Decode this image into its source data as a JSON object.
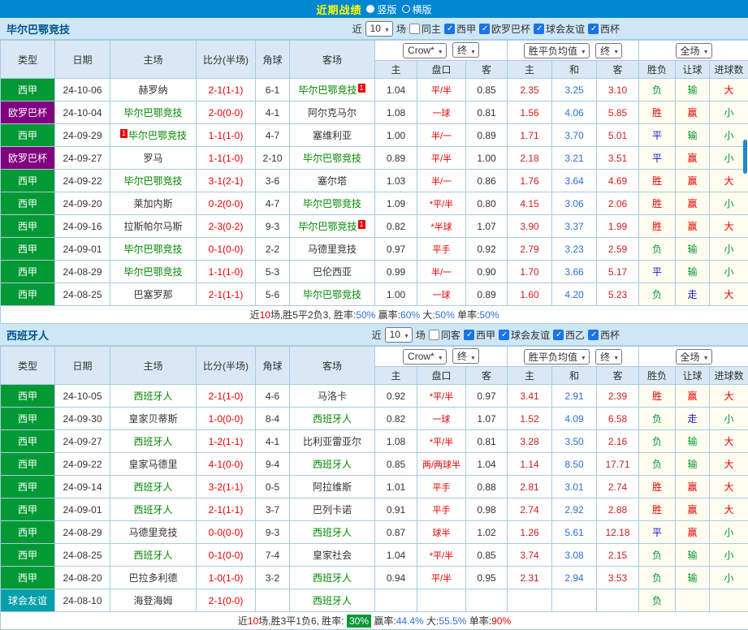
{
  "topbar": {
    "title": "近期战绩",
    "vertical": "竖版",
    "vertical_checked": true,
    "horizontal": "横版",
    "horizontal_checked": false
  },
  "colors": {
    "topbar_bg": "#0086d1",
    "title": "#ffff00",
    "section_bg": "#cde7f6",
    "league_green": "#009933",
    "league_purple": "#800080",
    "league_teal": "#00a0aa",
    "win_red": "#e60000",
    "lose_green": "#009933",
    "draw_blue": "#1414cc",
    "draw_odds_blue": "#2e6fd9",
    "badge_green": "#009933"
  },
  "sections": [
    {
      "team": "毕尔巴鄂竞技",
      "filter": {
        "near": "近",
        "count": "10",
        "games": "场",
        "same": {
          "label": "同主",
          "checked": false
        },
        "leagues": [
          {
            "label": "西甲",
            "checked": true
          },
          {
            "label": "欧罗巴杯",
            "checked": true
          },
          {
            "label": "球会友谊",
            "checked": true
          },
          {
            "label": "西杯",
            "checked": true
          }
        ]
      },
      "header": {
        "type": "类型",
        "date": "日期",
        "home": "主场",
        "score": "比分(半场)",
        "corner": "角球",
        "away": "客场",
        "odds_source": "Crow*",
        "odds_stage": "终",
        "europe_source": "胜平负均值",
        "europe_stage": "终",
        "scope": "全场",
        "sub": [
          "主",
          "盘口",
          "客",
          "主",
          "和",
          "客",
          "胜负",
          "让球",
          "进球数"
        ]
      },
      "rows": [
        {
          "league": "西甲",
          "lc": "green",
          "date": "24-10-06",
          "hpre": "",
          "home": "赫罗纳",
          "hpost": "",
          "hhl": false,
          "score": "2-1(1-1)",
          "corner": "6-1",
          "apre": "",
          "away": "毕尔巴鄂竞技",
          "apost": "1",
          "ahl": true,
          "oh": "1.04",
          "hcap": "平/半",
          "oa": "0.85",
          "eh": "2.35",
          "ed": "3.25",
          "ea": "3.10",
          "res": "负",
          "resc": "g",
          "hres": "输",
          "hresc": "g",
          "gres": "大",
          "gresc": "r"
        },
        {
          "league": "欧罗巴杯",
          "lc": "purple",
          "date": "24-10-04",
          "hpre": "",
          "home": "毕尔巴鄂竞技",
          "hpost": "",
          "hhl": true,
          "score": "2-0(0-0)",
          "corner": "4-1",
          "apre": "",
          "away": "阿尔克马尔",
          "apost": "",
          "ahl": false,
          "oh": "1.08",
          "hcap": "一球",
          "oa": "0.81",
          "eh": "1.56",
          "ed": "4.06",
          "ea": "5.85",
          "res": "胜",
          "resc": "r",
          "hres": "赢",
          "hresc": "r",
          "gres": "小",
          "gresc": "g"
        },
        {
          "league": "西甲",
          "lc": "green",
          "date": "24-09-29",
          "hpre": "1",
          "home": "毕尔巴鄂竞技",
          "hpost": "",
          "hhl": true,
          "score": "1-1(1-0)",
          "corner": "4-7",
          "apre": "",
          "away": "塞维利亚",
          "apost": "",
          "ahl": false,
          "oh": "1.00",
          "hcap": "半/一",
          "oa": "0.89",
          "eh": "1.71",
          "ed": "3.70",
          "ea": "5.01",
          "res": "平",
          "resc": "b",
          "hres": "输",
          "hresc": "g",
          "gres": "小",
          "gresc": "g"
        },
        {
          "league": "欧罗巴杯",
          "lc": "purple",
          "date": "24-09-27",
          "hpre": "",
          "home": "罗马",
          "hpost": "",
          "hhl": false,
          "score": "1-1(1-0)",
          "corner": "2-10",
          "apre": "",
          "away": "毕尔巴鄂竞技",
          "apost": "",
          "ahl": true,
          "oh": "0.89",
          "hcap": "平/半",
          "oa": "1.00",
          "eh": "2.18",
          "ed": "3.21",
          "ea": "3.51",
          "res": "平",
          "resc": "b",
          "hres": "赢",
          "hresc": "r",
          "gres": "小",
          "gresc": "g"
        },
        {
          "league": "西甲",
          "lc": "green",
          "date": "24-09-22",
          "hpre": "",
          "home": "毕尔巴鄂竞技",
          "hpost": "",
          "hhl": true,
          "score": "3-1(2-1)",
          "corner": "3-6",
          "apre": "",
          "away": "塞尔塔",
          "apost": "",
          "ahl": false,
          "oh": "1.03",
          "hcap": "半/一",
          "oa": "0.86",
          "eh": "1.76",
          "ed": "3.64",
          "ea": "4.69",
          "res": "胜",
          "resc": "r",
          "hres": "赢",
          "hresc": "r",
          "gres": "大",
          "gresc": "r"
        },
        {
          "league": "西甲",
          "lc": "green",
          "date": "24-09-20",
          "hpre": "",
          "home": "莱加内斯",
          "hpost": "",
          "hhl": false,
          "score": "0-2(0-0)",
          "corner": "4-7",
          "apre": "",
          "away": "毕尔巴鄂竞技",
          "apost": "",
          "ahl": true,
          "oh": "1.09",
          "hcap": "*平/半",
          "oa": "0.80",
          "eh": "4.15",
          "ed": "3.06",
          "ea": "2.06",
          "res": "胜",
          "resc": "r",
          "hres": "赢",
          "hresc": "r",
          "gres": "小",
          "gresc": "g"
        },
        {
          "league": "西甲",
          "lc": "green",
          "date": "24-09-16",
          "hpre": "",
          "home": "拉斯帕尔马斯",
          "hpost": "",
          "hhl": false,
          "score": "2-3(0-2)",
          "corner": "9-3",
          "apre": "",
          "away": "毕尔巴鄂竞技",
          "apost": "1",
          "ahl": true,
          "oh": "0.82",
          "hcap": "*半球",
          "oa": "1.07",
          "eh": "3.90",
          "ed": "3.37",
          "ea": "1.99",
          "res": "胜",
          "resc": "r",
          "hres": "赢",
          "hresc": "r",
          "gres": "大",
          "gresc": "r"
        },
        {
          "league": "西甲",
          "lc": "green",
          "date": "24-09-01",
          "hpre": "",
          "home": "毕尔巴鄂竞技",
          "hpost": "",
          "hhl": true,
          "score": "0-1(0-0)",
          "corner": "2-2",
          "apre": "",
          "away": "马德里竞技",
          "apost": "",
          "ahl": false,
          "oh": "0.97",
          "hcap": "平手",
          "oa": "0.92",
          "eh": "2.79",
          "ed": "3.23",
          "ea": "2.59",
          "res": "负",
          "resc": "g",
          "hres": "输",
          "hresc": "g",
          "gres": "小",
          "gresc": "g"
        },
        {
          "league": "西甲",
          "lc": "green",
          "date": "24-08-29",
          "hpre": "",
          "home": "毕尔巴鄂竞技",
          "hpost": "",
          "hhl": true,
          "score": "1-1(1-0)",
          "corner": "5-3",
          "apre": "",
          "away": "巴伦西亚",
          "apost": "",
          "ahl": false,
          "oh": "0.99",
          "hcap": "半/一",
          "oa": "0.90",
          "eh": "1.70",
          "ed": "3.66",
          "ea": "5.17",
          "res": "平",
          "resc": "b",
          "hres": "输",
          "hresc": "g",
          "gres": "小",
          "gresc": "g"
        },
        {
          "league": "西甲",
          "lc": "green",
          "date": "24-08-25",
          "hpre": "",
          "home": "巴塞罗那",
          "hpost": "",
          "hhl": false,
          "score": "2-1(1-1)",
          "corner": "5-6",
          "apre": "",
          "away": "毕尔巴鄂竞技",
          "apost": "",
          "ahl": true,
          "oh": "1.00",
          "hcap": "一球",
          "oa": "0.89",
          "eh": "1.60",
          "ed": "4.20",
          "ea": "5.23",
          "res": "负",
          "resc": "g",
          "hres": "走",
          "hresc": "b",
          "gres": "大",
          "gresc": "r"
        }
      ],
      "summary": [
        {
          "t": "近"
        },
        {
          "t": "10",
          "c": "#e60000"
        },
        {
          "t": "场,胜5平2负3, 胜率:"
        },
        {
          "t": "50%",
          "c": "#2e6fd9"
        },
        {
          "t": " 赢率:"
        },
        {
          "t": "60%",
          "c": "#2e6fd9"
        },
        {
          "t": " 大:"
        },
        {
          "t": "50%",
          "c": "#2e6fd9"
        },
        {
          "t": " 单率:"
        },
        {
          "t": "50%",
          "c": "#2e6fd9"
        }
      ]
    },
    {
      "team": "西班牙人",
      "filter": {
        "near": "近",
        "count": "10",
        "games": "场",
        "same": {
          "label": "同客",
          "checked": false
        },
        "leagues": [
          {
            "label": "西甲",
            "checked": true
          },
          {
            "label": "球会友谊",
            "checked": true
          },
          {
            "label": "西乙",
            "checked": true
          },
          {
            "label": "西杯",
            "checked": true
          }
        ]
      },
      "header": {
        "type": "类型",
        "date": "日期",
        "home": "主场",
        "score": "比分(半场)",
        "corner": "角球",
        "away": "客场",
        "odds_source": "Crow*",
        "odds_stage": "终",
        "europe_source": "胜平负均值",
        "europe_stage": "终",
        "scope": "全场",
        "sub": [
          "主",
          "盘口",
          "客",
          "主",
          "和",
          "客",
          "胜负",
          "让球",
          "进球数"
        ]
      },
      "rows": [
        {
          "league": "西甲",
          "lc": "green",
          "date": "24-10-05",
          "hpre": "",
          "home": "西班牙人",
          "hpost": "",
          "hhl": true,
          "score": "2-1(1-0)",
          "corner": "4-6",
          "apre": "",
          "away": "马洛卡",
          "apost": "",
          "ahl": false,
          "oh": "0.92",
          "hcap": "*平/半",
          "oa": "0.97",
          "eh": "3.41",
          "ed": "2.91",
          "ea": "2.39",
          "res": "胜",
          "resc": "r",
          "hres": "赢",
          "hresc": "r",
          "gres": "大",
          "gresc": "r"
        },
        {
          "league": "西甲",
          "lc": "green",
          "date": "24-09-30",
          "hpre": "",
          "home": "皇家贝蒂斯",
          "hpost": "",
          "hhl": false,
          "score": "1-0(0-0)",
          "corner": "8-4",
          "apre": "",
          "away": "西班牙人",
          "apost": "",
          "ahl": true,
          "oh": "0.82",
          "hcap": "一球",
          "oa": "1.07",
          "eh": "1.52",
          "ed": "4.09",
          "ea": "6.58",
          "res": "负",
          "resc": "g",
          "hres": "走",
          "hresc": "b",
          "gres": "小",
          "gresc": "g"
        },
        {
          "league": "西甲",
          "lc": "green",
          "date": "24-09-27",
          "hpre": "",
          "home": "西班牙人",
          "hpost": "",
          "hhl": true,
          "score": "1-2(1-1)",
          "corner": "4-1",
          "apre": "",
          "away": "比利亚雷亚尔",
          "apost": "",
          "ahl": false,
          "oh": "1.08",
          "hcap": "*平/半",
          "oa": "0.81",
          "eh": "3.28",
          "ed": "3.50",
          "ea": "2.16",
          "res": "负",
          "resc": "g",
          "hres": "输",
          "hresc": "g",
          "gres": "大",
          "gresc": "r"
        },
        {
          "league": "西甲",
          "lc": "green",
          "date": "24-09-22",
          "hpre": "",
          "home": "皇家马德里",
          "hpost": "",
          "hhl": false,
          "score": "4-1(0-0)",
          "corner": "9-4",
          "apre": "",
          "away": "西班牙人",
          "apost": "",
          "ahl": true,
          "oh": "0.85",
          "hcap": "两/两球半",
          "oa": "1.04",
          "eh": "1.14",
          "ed": "8.50",
          "ea": "17.71",
          "res": "负",
          "resc": "g",
          "hres": "输",
          "hresc": "g",
          "gres": "大",
          "gresc": "r"
        },
        {
          "league": "西甲",
          "lc": "green",
          "date": "24-09-14",
          "hpre": "",
          "home": "西班牙人",
          "hpost": "",
          "hhl": true,
          "score": "3-2(1-1)",
          "corner": "0-5",
          "apre": "",
          "away": "阿拉维斯",
          "apost": "",
          "ahl": false,
          "oh": "1.01",
          "hcap": "平手",
          "oa": "0.88",
          "eh": "2.81",
          "ed": "3.01",
          "ea": "2.74",
          "res": "胜",
          "resc": "r",
          "hres": "赢",
          "hresc": "r",
          "gres": "大",
          "gresc": "r"
        },
        {
          "league": "西甲",
          "lc": "green",
          "date": "24-09-01",
          "hpre": "",
          "home": "西班牙人",
          "hpost": "",
          "hhl": true,
          "score": "2-1(1-1)",
          "corner": "3-7",
          "apre": "",
          "away": "巴列卡诺",
          "apost": "",
          "ahl": false,
          "oh": "0.91",
          "hcap": "平手",
          "oa": "0.98",
          "eh": "2.74",
          "ed": "2.92",
          "ea": "2.88",
          "res": "胜",
          "resc": "r",
          "hres": "赢",
          "hresc": "r",
          "gres": "大",
          "gresc": "r"
        },
        {
          "league": "西甲",
          "lc": "green",
          "date": "24-08-29",
          "hpre": "",
          "home": "马德里竞技",
          "hpost": "",
          "hhl": false,
          "score": "0-0(0-0)",
          "corner": "9-3",
          "apre": "",
          "away": "西班牙人",
          "apost": "",
          "ahl": true,
          "oh": "0.87",
          "hcap": "球半",
          "oa": "1.02",
          "eh": "1.26",
          "ed": "5.61",
          "ea": "12.18",
          "res": "平",
          "resc": "b",
          "hres": "赢",
          "hresc": "r",
          "gres": "小",
          "gresc": "g"
        },
        {
          "league": "西甲",
          "lc": "green",
          "date": "24-08-25",
          "hpre": "",
          "home": "西班牙人",
          "hpost": "",
          "hhl": true,
          "score": "0-1(0-0)",
          "corner": "7-4",
          "apre": "",
          "away": "皇家社会",
          "apost": "",
          "ahl": false,
          "oh": "1.04",
          "hcap": "*平/半",
          "oa": "0.85",
          "eh": "3.74",
          "ed": "3.08",
          "ea": "2.15",
          "res": "负",
          "resc": "g",
          "hres": "输",
          "hresc": "g",
          "gres": "小",
          "gresc": "g"
        },
        {
          "league": "西甲",
          "lc": "green",
          "date": "24-08-20",
          "hpre": "",
          "home": "巴拉多利德",
          "hpost": "",
          "hhl": false,
          "score": "1-0(1-0)",
          "corner": "3-2",
          "apre": "",
          "away": "西班牙人",
          "apost": "",
          "ahl": true,
          "oh": "0.94",
          "hcap": "平/半",
          "oa": "0.95",
          "eh": "2.31",
          "ed": "2.94",
          "ea": "3.53",
          "res": "负",
          "resc": "g",
          "hres": "输",
          "hresc": "g",
          "gres": "小",
          "gresc": "g"
        },
        {
          "league": "球会友谊",
          "lc": "teal",
          "date": "24-08-10",
          "hpre": "",
          "home": "海登海姆",
          "hpost": "",
          "hhl": false,
          "score": "2-1(0-0)",
          "corner": "",
          "apre": "",
          "away": "西班牙人",
          "apost": "",
          "ahl": true,
          "oh": "",
          "hcap": "",
          "oa": "",
          "eh": "",
          "ed": "",
          "ea": "",
          "res": "负",
          "resc": "g",
          "hres": "",
          "hresc": "",
          "gres": "",
          "gresc": ""
        }
      ],
      "summary": [
        {
          "t": "近"
        },
        {
          "t": "10",
          "c": "#e60000"
        },
        {
          "t": "场,胜3平1负6, 胜率: "
        },
        {
          "t": "30%",
          "c": "#ffffff",
          "bg": "#009933"
        },
        {
          "t": " 赢率:"
        },
        {
          "t": "44.4%",
          "c": "#2e6fd9"
        },
        {
          "t": " 大:"
        },
        {
          "t": "55.5%",
          "c": "#2e6fd9"
        },
        {
          "t": " 单率:"
        },
        {
          "t": "90%",
          "c": "#e60000"
        }
      ]
    }
  ]
}
